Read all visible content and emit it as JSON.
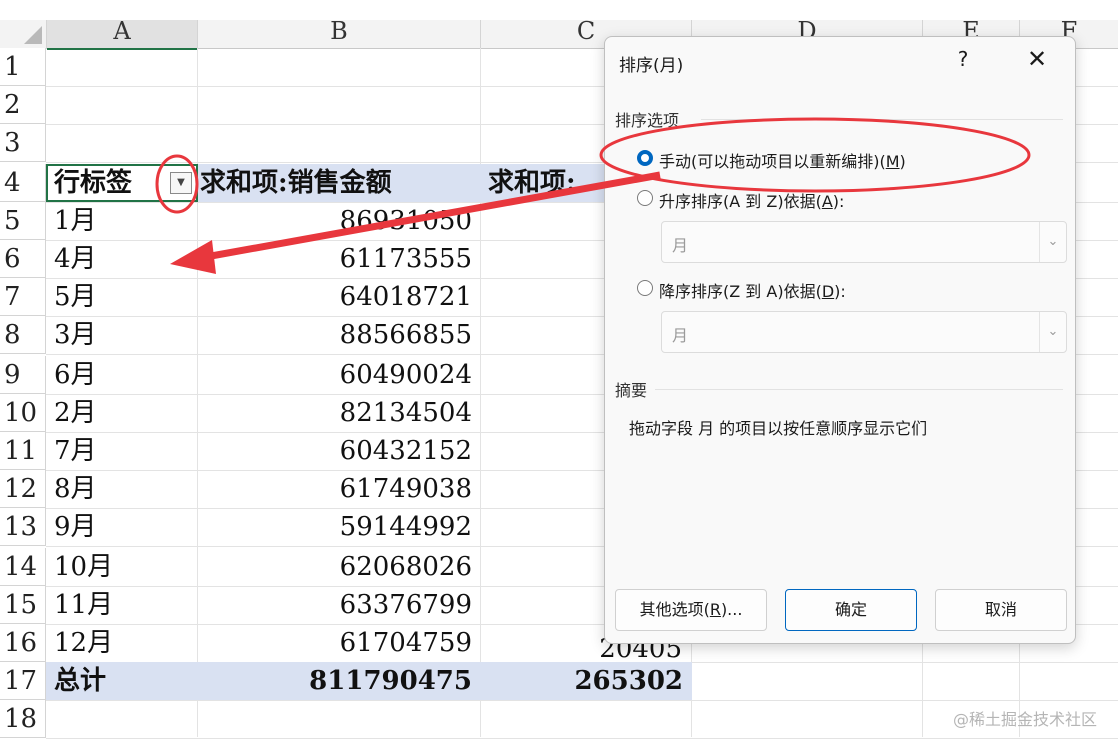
{
  "columns": [
    "A",
    "B",
    "C",
    "D",
    "E",
    "F"
  ],
  "rows": [
    "1",
    "2",
    "3",
    "4",
    "5",
    "6",
    "7",
    "8",
    "9",
    "10",
    "11",
    "12",
    "13",
    "14",
    "15",
    "16",
    "17",
    "18"
  ],
  "pivot": {
    "header_a": "行标签",
    "header_b": "求和项:销售金额",
    "header_c": "求和项:",
    "data": [
      {
        "label": "1月",
        "value": "86931050"
      },
      {
        "label": "4月",
        "value": "61173555"
      },
      {
        "label": "5月",
        "value": "64018721"
      },
      {
        "label": "3月",
        "value": "88566855"
      },
      {
        "label": "6月",
        "value": "60490024"
      },
      {
        "label": "2月",
        "value": "82134504"
      },
      {
        "label": "7月",
        "value": "60432152"
      },
      {
        "label": "8月",
        "value": "61749038"
      },
      {
        "label": "9月",
        "value": "59144992"
      },
      {
        "label": "10月",
        "value": "62068026"
      },
      {
        "label": "11月",
        "value": "63376799"
      },
      {
        "label": "12月",
        "value": "61704759"
      }
    ],
    "row16_c_partial": "20405",
    "total_label": "总计",
    "total_b": "811790475",
    "total_c": "265302"
  },
  "dialog": {
    "title": "排序(月)",
    "help": "?",
    "close": "✕",
    "group_options": "排序选项",
    "manual_label": "手动(可以拖动项目以重新编排)(",
    "manual_key": "M",
    "asc_label": "升序排序(A 到 Z)依据(",
    "asc_key": "A",
    "asc_value": "月",
    "desc_label": "降序排序(Z 到 A)依据(",
    "desc_key": "D",
    "desc_value": "月",
    "group_summary": "摘要",
    "summary_text": "拖动字段 月 的项目以按任意顺序显示它们",
    "btn_more": "其他选项(",
    "btn_more_key": "R",
    "btn_more_tail": ")...",
    "btn_ok": "确定",
    "btn_cancel": "取消"
  },
  "watermark": "@稀土掘金技术社区",
  "colors": {
    "accent": "#0067c0",
    "annotation": "#e8373d",
    "band": "#d9e1f2"
  }
}
